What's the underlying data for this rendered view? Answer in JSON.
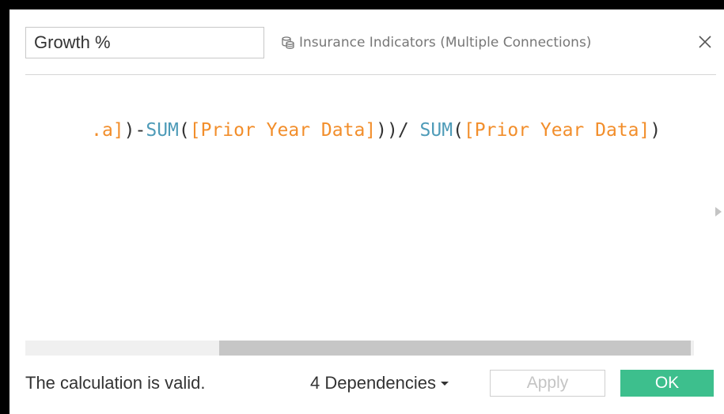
{
  "calculation": {
    "name": "Growth %",
    "datasource": {
      "icon": "datasource-connections-icon",
      "label": "Insurance Indicators (Multiple Connections)"
    },
    "close_icon": "close-icon",
    "formula_tokens": [
      {
        "text": ".a]",
        "kind": "field"
      },
      {
        "text": ")-",
        "kind": "op"
      },
      {
        "text": "SUM",
        "kind": "func"
      },
      {
        "text": "(",
        "kind": "op"
      },
      {
        "text": "[Prior Year Data]",
        "kind": "field"
      },
      {
        "text": "))/ ",
        "kind": "op"
      },
      {
        "text": "SUM",
        "kind": "func"
      },
      {
        "text": "(",
        "kind": "op"
      },
      {
        "text": "[Prior Year Data]",
        "kind": "field"
      },
      {
        "text": ")",
        "kind": "op"
      }
    ]
  },
  "footer": {
    "status": "The calculation is valid.",
    "dependencies_label": "4 Dependencies",
    "apply_label": "Apply",
    "ok_label": "OK"
  },
  "colors": {
    "field": "#f28e2b",
    "function": "#4e9bb8",
    "ok_button": "#3dbf8d"
  }
}
